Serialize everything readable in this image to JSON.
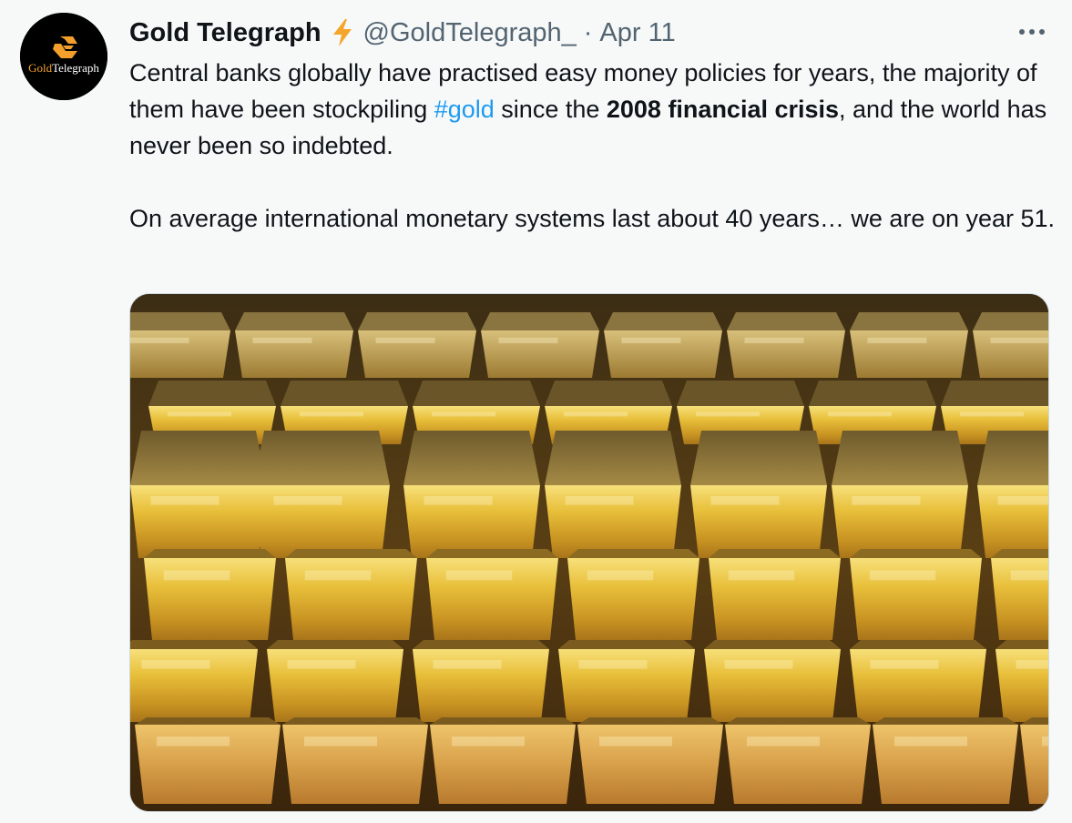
{
  "tweet": {
    "author_name": "Gold Telegraph",
    "verified_icon": "lightning-bolt-icon",
    "handle": "@GoldTelegraph_",
    "separator": "·",
    "date": "Apr 11",
    "more_icon": "more-icon",
    "avatar_logo_text": "GoldTelegraph",
    "body": {
      "p1_a": "Central banks globally have practised easy money policies for years, the majority of them have been stockpiling ",
      "hashtag": "#gold",
      "p1_b": " since the ",
      "bold1": "2008 financial crisis",
      "p1_c": ", and the world has never been so indebted.",
      "p2": "On average international monetary systems last about 40 years… we are on year 51."
    },
    "media": {
      "type": "photo",
      "subject": "stacked-gold-bars"
    }
  },
  "colors": {
    "background": "#f7f9f9",
    "text": "#0f1419",
    "secondary_text": "#536471",
    "link": "#1d9bf0",
    "bolt": "#f4a52a",
    "logo_orange": "#f29f2b"
  }
}
